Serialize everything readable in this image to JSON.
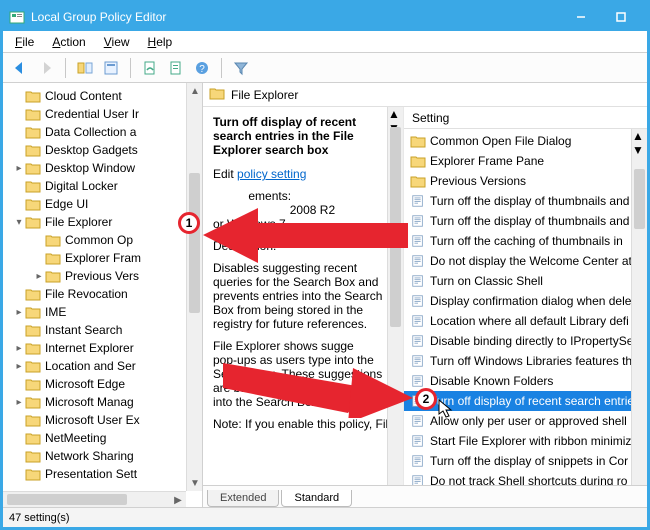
{
  "window": {
    "title": "Local Group Policy Editor"
  },
  "menus": {
    "file": "File",
    "action": "Action",
    "view": "View",
    "help": "Help"
  },
  "toolbar": {
    "back": "back",
    "forward": "forward",
    "up": "up",
    "show": "show",
    "refresh": "refresh",
    "export": "export",
    "properties": "properties",
    "help": "help",
    "filter": "filter"
  },
  "tree": {
    "items": [
      {
        "label": "Cloud Content",
        "depth": 0,
        "twisty": ""
      },
      {
        "label": "Credential User Ir",
        "depth": 0,
        "twisty": ""
      },
      {
        "label": "Data Collection a",
        "depth": 0,
        "twisty": ""
      },
      {
        "label": "Desktop Gadgets",
        "depth": 0,
        "twisty": ""
      },
      {
        "label": "Desktop Window",
        "depth": 0,
        "twisty": ">"
      },
      {
        "label": "Digital Locker",
        "depth": 0,
        "twisty": ""
      },
      {
        "label": "Edge UI",
        "depth": 0,
        "twisty": ""
      },
      {
        "label": "File Explorer",
        "depth": 0,
        "twisty": "v",
        "selected": true
      },
      {
        "label": "Common Op",
        "depth": 1,
        "twisty": ""
      },
      {
        "label": "Explorer Fram",
        "depth": 1,
        "twisty": ""
      },
      {
        "label": "Previous Vers",
        "depth": 1,
        "twisty": ">"
      },
      {
        "label": "File Revocation",
        "depth": 0,
        "twisty": ""
      },
      {
        "label": "IME",
        "depth": 0,
        "twisty": ">"
      },
      {
        "label": "Instant Search",
        "depth": 0,
        "twisty": ""
      },
      {
        "label": "Internet Explorer",
        "depth": 0,
        "twisty": ">"
      },
      {
        "label": "Location and Ser",
        "depth": 0,
        "twisty": ">"
      },
      {
        "label": "Microsoft Edge",
        "depth": 0,
        "twisty": ""
      },
      {
        "label": "Microsoft Manag",
        "depth": 0,
        "twisty": ">"
      },
      {
        "label": "Microsoft User Ex",
        "depth": 0,
        "twisty": ""
      },
      {
        "label": "NetMeeting",
        "depth": 0,
        "twisty": ""
      },
      {
        "label": "Network Sharing",
        "depth": 0,
        "twisty": ""
      },
      {
        "label": "Presentation Sett",
        "depth": 0,
        "twisty": ""
      }
    ]
  },
  "right_header": {
    "title": "File Explorer"
  },
  "description": {
    "title": "Turn off display of recent search entries in the File Explorer search box",
    "edit_label": "Edit",
    "policy_link": "policy setting",
    "req_label": "ements:",
    "req_line2": "2008 R2",
    "req_line3": "or Windows 7",
    "desc_heading": "Description:",
    "para1": "Disables suggesting recent queries for the Search Box and prevents entries into the Search Box from being stored in the registry for future references.",
    "para2_a": "File Explorer shows sugge",
    "para2_b": "pop-ups as users type into the Search Box.  These suggestions are based on their past entries into the Search Box.",
    "note": "Note: If you enable this policy, File"
  },
  "list": {
    "header": "Setting",
    "items": [
      {
        "type": "folder",
        "label": "Common Open File Dialog"
      },
      {
        "type": "folder",
        "label": "Explorer Frame Pane"
      },
      {
        "type": "folder",
        "label": "Previous Versions"
      },
      {
        "type": "setting",
        "label": "Turn off the display of thumbnails and"
      },
      {
        "type": "setting",
        "label": "Turn off the display of thumbnails and"
      },
      {
        "type": "setting",
        "label": "Turn off the caching of thumbnails in"
      },
      {
        "type": "setting",
        "label": "Do not display the Welcome Center at"
      },
      {
        "type": "setting",
        "label": "Turn on Classic Shell"
      },
      {
        "type": "setting",
        "label": "Display confirmation dialog when dele"
      },
      {
        "type": "setting",
        "label": "Location where all default Library defi"
      },
      {
        "type": "setting",
        "label": "Disable binding directly to IPropertySe"
      },
      {
        "type": "setting",
        "label": "Turn off Windows Libraries features th"
      },
      {
        "type": "setting",
        "label": "Disable Known Folders"
      },
      {
        "type": "setting",
        "label": "Turn off display of recent search entrie",
        "selected": true
      },
      {
        "type": "setting",
        "label": "Allow only per user or approved shell"
      },
      {
        "type": "setting",
        "label": "Start File Explorer with ribbon minimiz"
      },
      {
        "type": "setting",
        "label": "Turn off the display of snippets in Cor"
      },
      {
        "type": "setting",
        "label": "Do not track Shell shortcuts during ro"
      }
    ]
  },
  "tabs": {
    "extended": "Extended",
    "standard": "Standard"
  },
  "status": {
    "text": "47 setting(s)"
  },
  "annotations": {
    "marker1": "1",
    "marker2": "2"
  }
}
